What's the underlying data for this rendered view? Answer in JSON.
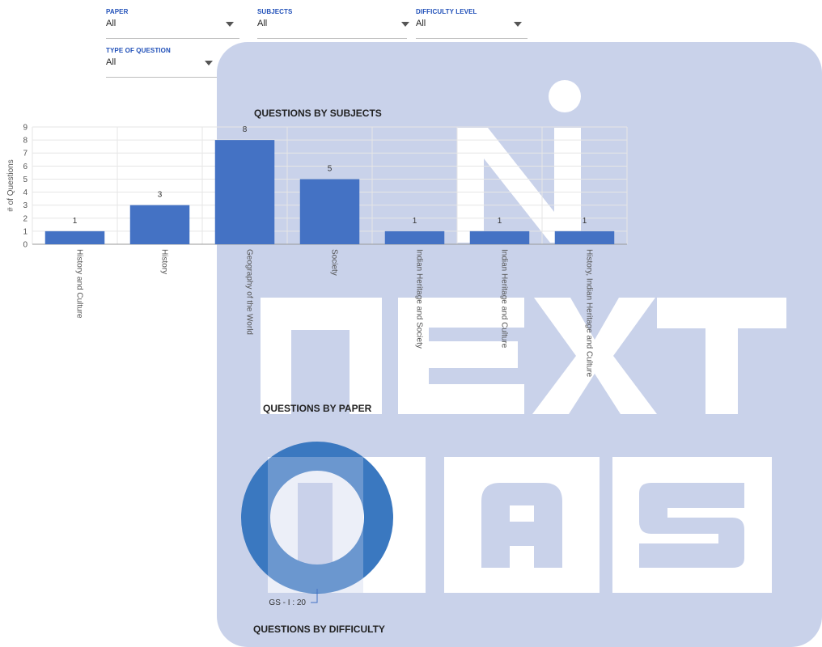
{
  "filters": {
    "paper": {
      "label": "PAPER",
      "value": "All"
    },
    "subjects": {
      "label": "SUBJECTS",
      "value": "All"
    },
    "difficulty": {
      "label": "DIFFICULTY LEVEL",
      "value": "All"
    },
    "question_type": {
      "label": "TYPE OF QUESTION",
      "value": "All"
    }
  },
  "sections": {
    "subjects_title": "QUESTIONS BY SUBJECTS",
    "paper_title": "QUESTIONS BY PAPER",
    "difficulty_title": "QUESTIONS BY DIFFICULTY"
  },
  "watermark": {
    "brand_color": "#c9d2ea",
    "text_color": "#ffffff",
    "lines": [
      "NEXT",
      "IAS"
    ]
  },
  "colors": {
    "bar": "#4472c4",
    "donut": "#3a78c0",
    "grid": "#e6e6e6"
  },
  "chart_data": [
    {
      "type": "bar",
      "title": "QUESTIONS BY SUBJECTS",
      "ylabel": "# of Questions",
      "xlabel": "",
      "ylim": [
        0,
        9
      ],
      "yticks": [
        0,
        1,
        2,
        3,
        4,
        5,
        6,
        7,
        8,
        9
      ],
      "grid": true,
      "categories": [
        "History and Culture",
        "History",
        "Geography of the World",
        "Society",
        "Indian Heritage and Society",
        "Indian Heritage and Culture",
        "History, Indian Heritage and Culture"
      ],
      "values": [
        1,
        3,
        8,
        5,
        1,
        1,
        1
      ],
      "data_labels": true
    },
    {
      "type": "pie",
      "title": "QUESTIONS BY PAPER",
      "donut": true,
      "categories": [
        "GS - I"
      ],
      "values": [
        20
      ],
      "labels": [
        "GS - I : 20"
      ]
    }
  ]
}
